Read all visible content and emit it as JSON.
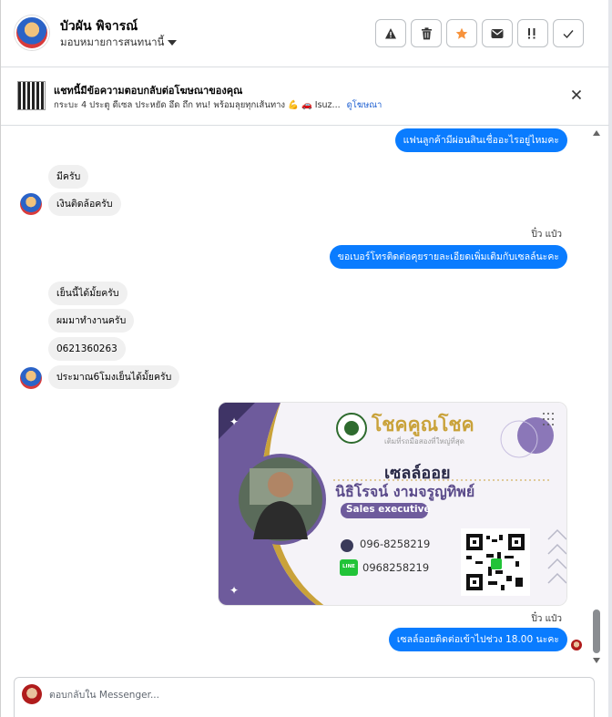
{
  "header": {
    "name": "บัวผัน พิจารณ์",
    "assign_label": "มอบหมายการสนทนานี้",
    "actions": [
      "warning-icon",
      "trash-icon",
      "star-icon",
      "envelope-icon",
      "important-icon",
      "check-icon"
    ],
    "star_color": "#f7923b"
  },
  "ad_notice": {
    "title": "แชทนี้มีข้อความตอบกลับต่อโฆษณาของคุณ",
    "subtitle": "กระบะ 4 ประตู ดีเซล ประหยัด อึด ถึก ทน! พร้อมลุยทุกเส้นทาง 💪 🚗 Isuz...",
    "link": "ดูโฆษณา"
  },
  "messages": {
    "m1": "แฟนลูกค้ามีผ่อนสินเชื่ออะไรอยู่ไหมคะ",
    "m2": "มีครับ",
    "m3": "เงินติดล้อครับ",
    "sender1": "ปิ๋ว แป๋ว",
    "m4": "ขอเบอร์โทรติดต่อคุยรายละเอียดเพิ่มเติมกับเซลล์นะคะ",
    "m5": "เย็นนี้ได้มั้ยครับ",
    "m6": "ผมมาทำงานครับ",
    "m7": "0621360263",
    "m8": "ประมาณ6โมงเย็นได้มั้ยครับ",
    "sender2": "ปิ๋ว แป๋ว",
    "m9": "เซลล์ออยติดต่อเข้าไปช่วง 18.00 นะคะ"
  },
  "business_card": {
    "brand": "โชคคูณโชค",
    "tagline": "เติมที่รถมือสองที่ใหญ่ที่สุด",
    "nickname": "เซลล์ออย",
    "fullname": "นิธิโรจน์  งามจรูญทิพย์",
    "role": "Sales executive",
    "phone": "096-8258219",
    "line_badge": "LINE",
    "line_id": "0968258219"
  },
  "composer": {
    "placeholder": "ตอบกลับใน Messenger..."
  },
  "colors": {
    "accent": "#0a7cff",
    "card_purple": "#6e5b9c",
    "card_gold": "#c9a23a"
  }
}
